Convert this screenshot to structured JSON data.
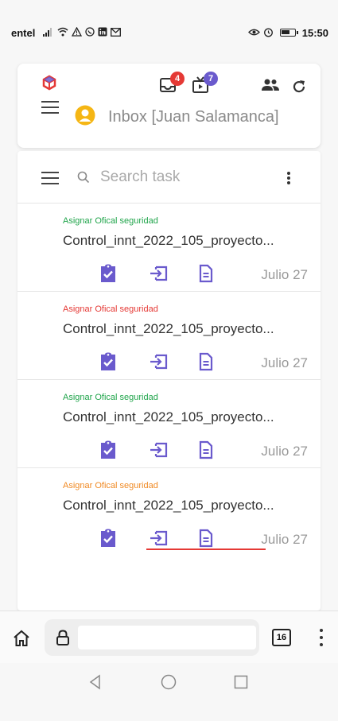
{
  "status_bar": {
    "carrier": "entel",
    "time": "15:50"
  },
  "header": {
    "inbox_title": "Inbox [Juan Salamanca]",
    "tray_badge": "4",
    "film_badge": "7"
  },
  "search": {
    "placeholder": "Search task"
  },
  "tasks": [
    {
      "tag": "Asignar Ofical seguridad",
      "tag_color": "#1fa44a",
      "name": "Control_innt_2022_105_proyecto...",
      "date": "Julio 27"
    },
    {
      "tag": "Asignar Ofical seguridad",
      "tag_color": "#e53935",
      "name": "Control_innt_2022_105_proyecto...",
      "date": "Julio 27"
    },
    {
      "tag": "Asignar Ofical seguridad",
      "tag_color": "#1fa44a",
      "name": "Control_innt_2022_105_proyecto...",
      "date": "Julio 27"
    },
    {
      "tag": "Asignar Ofical seguridad",
      "tag_color": "#f08a24",
      "name": "Control_innt_2022_105_proyecto...",
      "date": "Julio 27"
    }
  ],
  "icons": {
    "action_color": "#6a5acd"
  },
  "browser": {
    "url": "",
    "tab_count": "16"
  }
}
